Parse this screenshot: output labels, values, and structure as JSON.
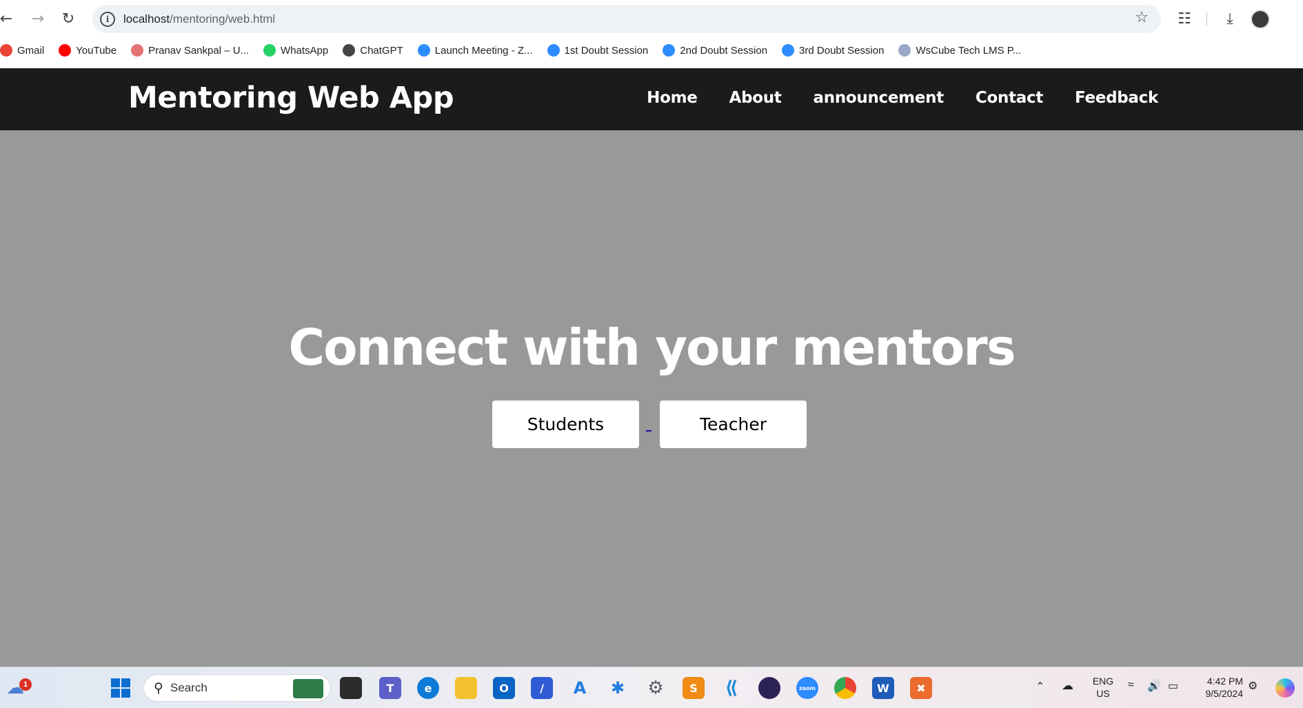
{
  "browser": {
    "url_host": "localhost",
    "url_path": "/mentoring/web.html",
    "bookmarks": [
      {
        "label": "Gmail",
        "icon": "gmail-icon",
        "color": "#ea4335"
      },
      {
        "label": "YouTube",
        "icon": "youtube-icon",
        "color": "#ff0000"
      },
      {
        "label": "Pranav Sankpal – U...",
        "icon": "bookmark-icon",
        "color": "#e57373"
      },
      {
        "label": "WhatsApp",
        "icon": "whatsapp-icon",
        "color": "#25d366"
      },
      {
        "label": "ChatGPT",
        "icon": "chatgpt-icon",
        "color": "#444444"
      },
      {
        "label": "Launch Meeting - Z...",
        "icon": "zoom-icon",
        "color": "#2d8cff"
      },
      {
        "label": "1st Doubt Session",
        "icon": "zoom-icon",
        "color": "#2d8cff"
      },
      {
        "label": "2nd Doubt Session",
        "icon": "zoom-icon",
        "color": "#2d8cff"
      },
      {
        "label": "3rd Doubt Session",
        "icon": "zoom-icon",
        "color": "#2d8cff"
      },
      {
        "label": "WsCube Tech LMS P...",
        "icon": "wscube-icon",
        "color": "#9aa7c7"
      }
    ]
  },
  "site": {
    "brand": "Mentoring Web App",
    "nav": [
      "Home",
      "About",
      "announcement",
      "Contact",
      "Feedback"
    ],
    "hero_title": "Connect with your mentors",
    "buttons": {
      "students": "Students",
      "teacher": "Teacher"
    }
  },
  "taskbar": {
    "search_label": "Search",
    "weather_badge": "1",
    "lang": "ENG",
    "region": "US",
    "time": "4:42 PM",
    "date": "9/5/2024"
  },
  "colors": {
    "header_bg": "#1b1b1b",
    "hero_bg": "#999999",
    "button_bg": "#ffffff"
  }
}
